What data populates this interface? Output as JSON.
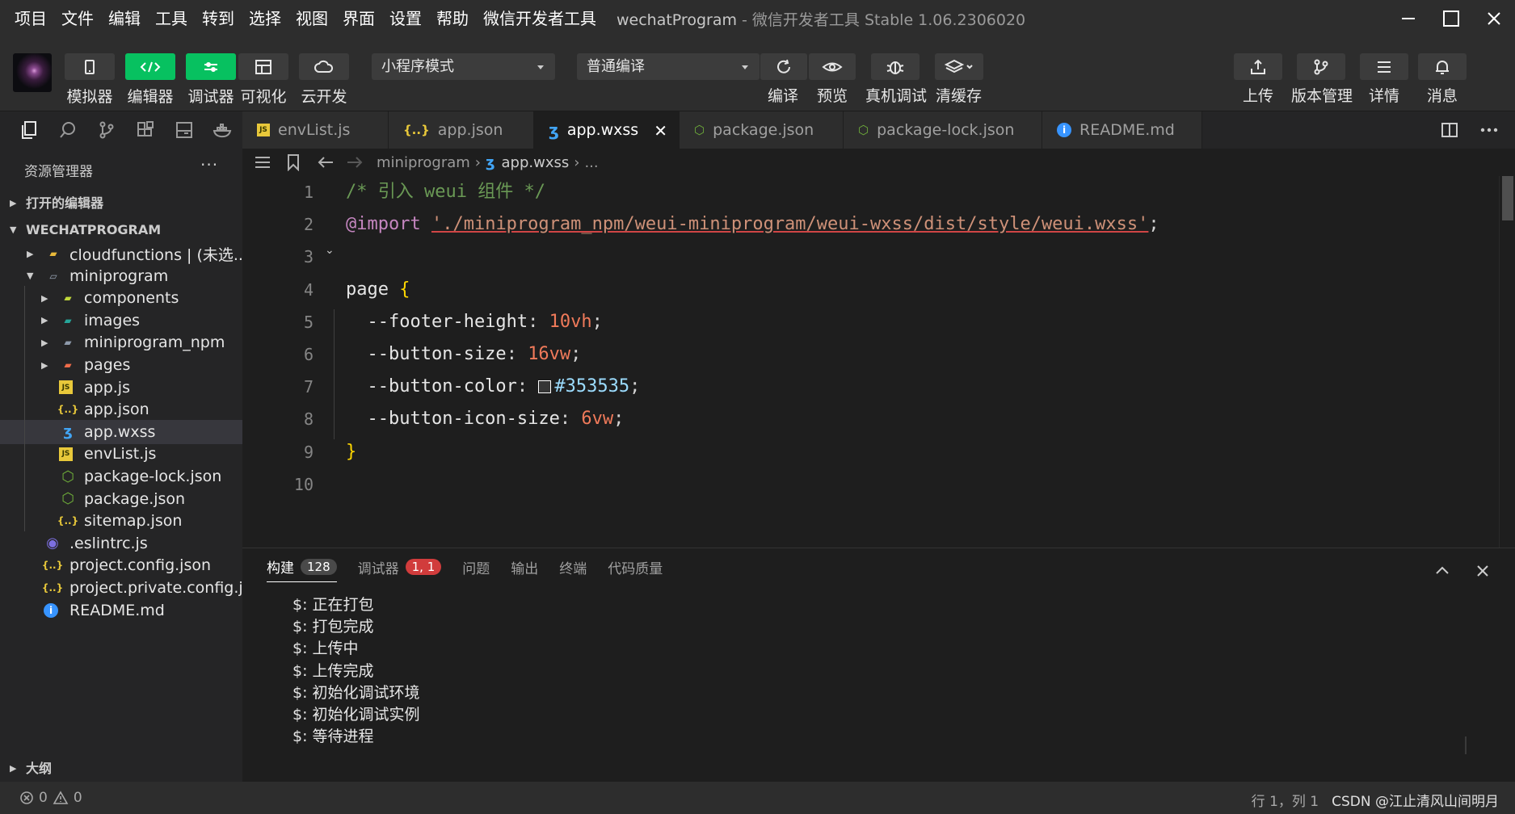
{
  "menu": [
    "项目",
    "文件",
    "编辑",
    "工具",
    "转到",
    "选择",
    "视图",
    "界面",
    "设置",
    "帮助",
    "微信开发者工具"
  ],
  "window": {
    "app_name": "wechatProgram",
    "subtitle": " - 微信开发者工具 Stable 1.06.2306020"
  },
  "toolbar": {
    "left_buttons": [
      {
        "label": "模拟器",
        "icon": "phone-icon",
        "active": false
      },
      {
        "label": "编辑器",
        "icon": "code-icon",
        "active": true
      },
      {
        "label": "调试器",
        "icon": "sliders-icon",
        "active": true
      },
      {
        "label": "可视化",
        "icon": "layout-icon",
        "active": false
      },
      {
        "label": "云开发",
        "icon": "cloud-icon",
        "active": false
      }
    ],
    "mode_select": "小程序模式",
    "compile_select": "普通编译",
    "compile_label": "编译",
    "preview_label": "预览",
    "remote_debug_label": "真机调试",
    "clear_cache_label": "清缓存",
    "right_buttons": [
      {
        "label": "上传",
        "icon": "upload-icon"
      },
      {
        "label": "版本管理",
        "icon": "branch-icon"
      },
      {
        "label": "详情",
        "icon": "menu-icon"
      },
      {
        "label": "消息",
        "icon": "bell-icon"
      }
    ]
  },
  "tabs": [
    {
      "label": "envList.js",
      "icon": "js-icon",
      "active": false
    },
    {
      "label": "app.json",
      "icon": "json-icon",
      "active": false
    },
    {
      "label": "app.wxss",
      "icon": "css-icon",
      "active": true
    },
    {
      "label": "package.json",
      "icon": "node-icon",
      "active": false
    },
    {
      "label": "package-lock.json",
      "icon": "node-icon",
      "active": false
    },
    {
      "label": "README.md",
      "icon": "info-icon",
      "active": false
    }
  ],
  "sidebar": {
    "title": "资源管理器",
    "more": "···",
    "section_open_editors": "打开的编辑器",
    "section_project": "WECHATPROGRAM",
    "section_outline": "大纲",
    "tree": [
      {
        "label": "cloudfunctions | (未选...",
        "icon": "folder-cloud-icon",
        "level": 0,
        "arrow": "right"
      },
      {
        "label": "miniprogram",
        "icon": "folder-open-icon",
        "level": 0,
        "arrow": "down"
      },
      {
        "label": "components",
        "icon": "folder-components-icon",
        "level": 1,
        "arrow": "right"
      },
      {
        "label": "images",
        "icon": "folder-images-icon",
        "level": 1,
        "arrow": "right"
      },
      {
        "label": "miniprogram_npm",
        "icon": "folder-icon",
        "level": 1,
        "arrow": "right"
      },
      {
        "label": "pages",
        "icon": "folder-pages-icon",
        "level": 1,
        "arrow": "right"
      },
      {
        "label": "app.js",
        "icon": "js-icon",
        "level": 1,
        "arrow": ""
      },
      {
        "label": "app.json",
        "icon": "json-icon",
        "level": 1,
        "arrow": ""
      },
      {
        "label": "app.wxss",
        "icon": "css-icon",
        "level": 1,
        "arrow": "",
        "selected": true
      },
      {
        "label": "envList.js",
        "icon": "js-icon",
        "level": 1,
        "arrow": ""
      },
      {
        "label": "package-lock.json",
        "icon": "node-icon",
        "level": 1,
        "arrow": ""
      },
      {
        "label": "package.json",
        "icon": "node-icon",
        "level": 1,
        "arrow": ""
      },
      {
        "label": "sitemap.json",
        "icon": "json-icon",
        "level": 1,
        "arrow": ""
      },
      {
        "label": ".eslintrc.js",
        "icon": "eslint-icon",
        "level": 0,
        "arrow": ""
      },
      {
        "label": "project.config.json",
        "icon": "json-icon",
        "level": 0,
        "arrow": ""
      },
      {
        "label": "project.private.config.js...",
        "icon": "json-icon",
        "level": 0,
        "arrow": ""
      },
      {
        "label": "README.md",
        "icon": "info-icon",
        "level": 0,
        "arrow": ""
      }
    ]
  },
  "breadcrumb": {
    "folder": "miniprogram",
    "file": "app.wxss",
    "tail": "..."
  },
  "editor": {
    "lines": [
      {
        "n": "1",
        "tokens": [
          [
            "c-comment",
            "/* 引入 weui 组件 */"
          ]
        ]
      },
      {
        "n": "2",
        "tokens": [
          [
            "c-kw",
            "@import"
          ],
          [
            "c-punc",
            " "
          ],
          [
            "c-str",
            "'./miniprogram_npm/weui-miniprogram/weui-wxss/dist/style/weui.wxss'"
          ],
          [
            "c-punc",
            ";"
          ]
        ]
      },
      {
        "n": "3",
        "tokens": []
      },
      {
        "n": "4",
        "tokens": [
          [
            "c-text",
            "page "
          ],
          [
            "c-brace",
            "{"
          ]
        ]
      },
      {
        "n": "5",
        "tokens": [
          [
            "c-text",
            "  --footer-height"
          ],
          [
            "c-punc",
            ": "
          ],
          [
            "c-num2",
            "10vh"
          ],
          [
            "c-punc",
            ";"
          ]
        ]
      },
      {
        "n": "6",
        "tokens": [
          [
            "c-text",
            "  --button-size"
          ],
          [
            "c-punc",
            ": "
          ],
          [
            "c-num2",
            "16vw"
          ],
          [
            "c-punc",
            ";"
          ]
        ]
      },
      {
        "n": "7",
        "tokens": [
          [
            "c-text",
            "  --button-color"
          ],
          [
            "c-punc",
            ": "
          ],
          [
            "swatch",
            ""
          ],
          [
            "c-prop",
            "#353535"
          ],
          [
            "c-punc",
            ";"
          ]
        ]
      },
      {
        "n": "8",
        "tokens": [
          [
            "c-text",
            "  --button-icon-size"
          ],
          [
            "c-punc",
            ": "
          ],
          [
            "c-num2",
            "6vw"
          ],
          [
            "c-punc",
            ";"
          ]
        ]
      },
      {
        "n": "9",
        "tokens": [
          [
            "c-brace",
            "}"
          ]
        ]
      },
      {
        "n": "10",
        "tokens": []
      }
    ]
  },
  "panel": {
    "tabs": [
      {
        "label": "构建",
        "badge": "128",
        "badge_color": "gray",
        "active": true
      },
      {
        "label": "调试器",
        "badge": "1, 1",
        "badge_color": "red",
        "active": false
      },
      {
        "label": "问题",
        "badge": "",
        "active": false
      },
      {
        "label": "输出",
        "badge": "",
        "active": false
      },
      {
        "label": "终端",
        "badge": "",
        "active": false
      },
      {
        "label": "代码质量",
        "badge": "",
        "active": false
      }
    ],
    "log": [
      "$: 正在打包",
      "$: 打包完成",
      "$: 上传中",
      "$: 上传完成",
      "$: 初始化调试环境",
      "$: 初始化调试实例",
      "$: 等待进程"
    ]
  },
  "status": {
    "errors": "0",
    "warnings": "0",
    "cursor": "行 1，列 1",
    "watermark": "CSDN @江止清风山间明月"
  },
  "colors": {
    "accent_green": "#07c160",
    "badge_red": "#d13c3c",
    "background": "#1e1e1e"
  }
}
